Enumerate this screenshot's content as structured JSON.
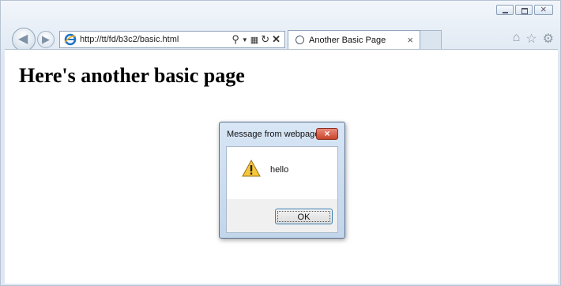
{
  "browser": {
    "address_bar": {
      "url": "http://tt/fd/b3c2/basic.html"
    },
    "tab": {
      "title": "Another Basic Page",
      "close": "×"
    },
    "window_controls": [
      "minimize",
      "maximize",
      "close"
    ],
    "toolbar_icons": [
      "home-icon",
      "favorites-star-icon",
      "tools-gear-icon"
    ]
  },
  "page": {
    "heading": "Here's another basic page"
  },
  "dialog": {
    "title": "Message from webpage",
    "close_label": "×",
    "icon": "warning-icon",
    "message": "hello",
    "ok_label": "OK"
  }
}
